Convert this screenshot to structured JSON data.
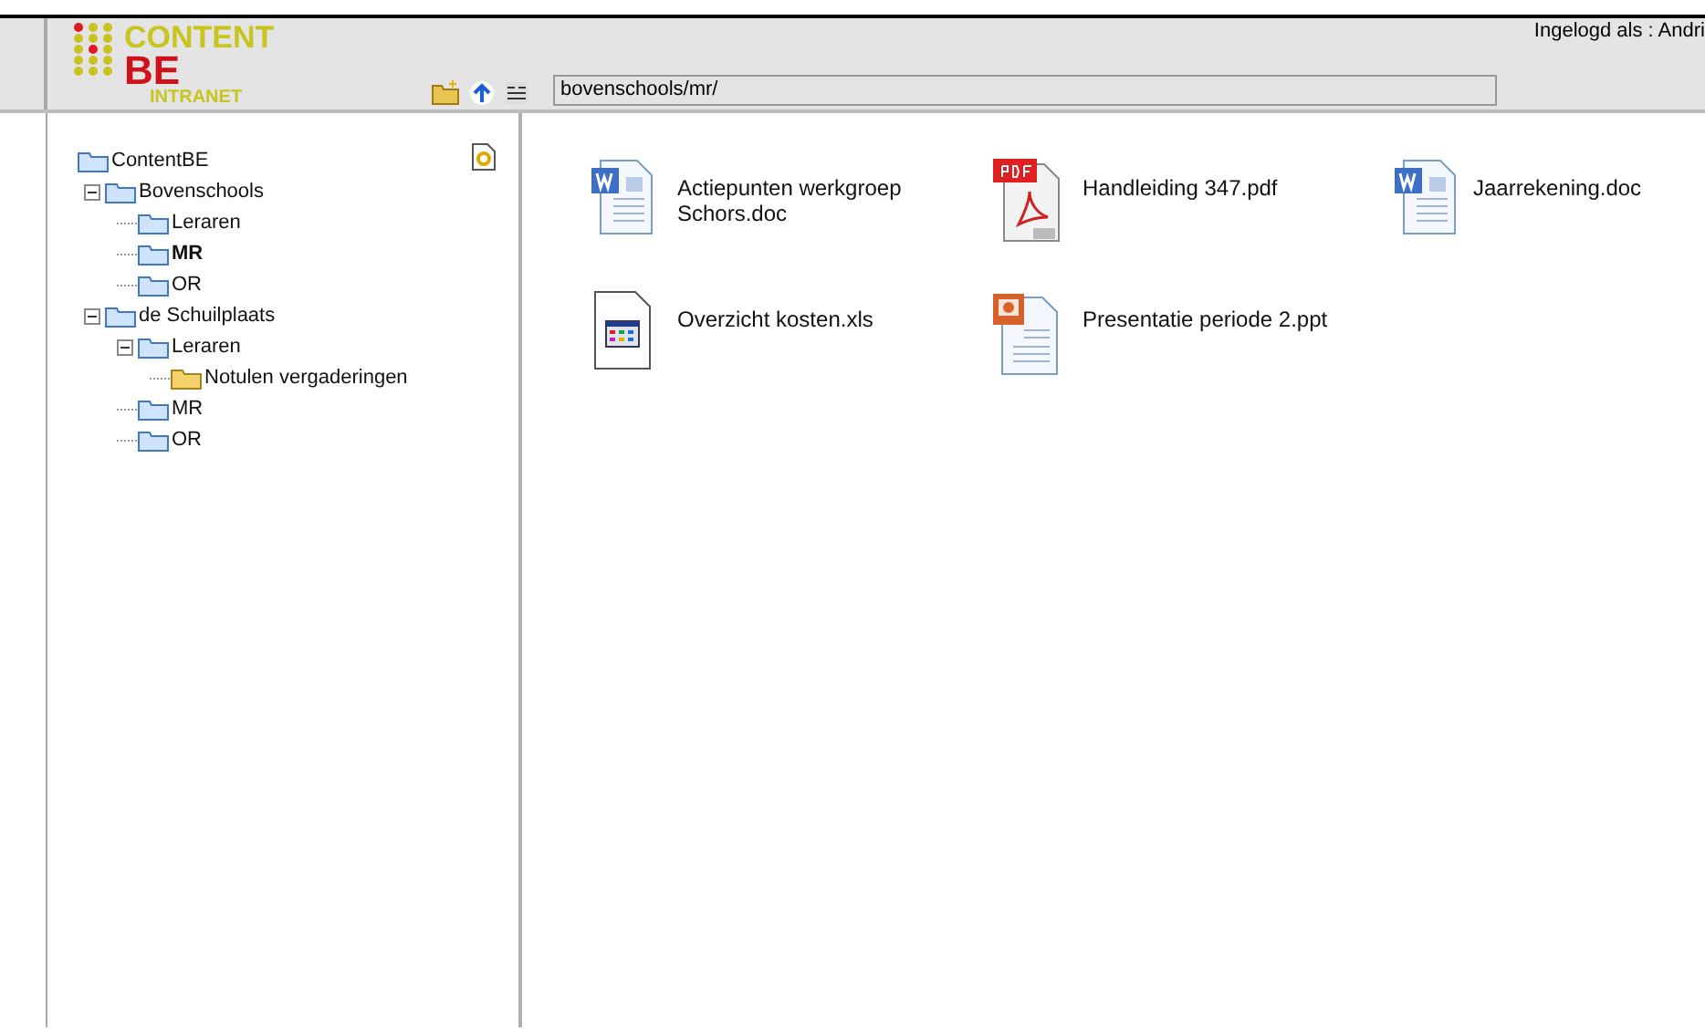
{
  "logo": {
    "line_1": "CONTENT",
    "line_2": "BE",
    "line_3": "INTRANET"
  },
  "user_label": "Ingelogd als : Andri",
  "path_field": {
    "value": "bovenschools/mr/"
  },
  "tree": [
    {
      "label": "ContentBE",
      "selected": false,
      "children": [
        {
          "label": "Bovenschools",
          "selected": false,
          "expanded": true,
          "children": [
            {
              "label": "Leraren",
              "selected": false
            },
            {
              "label": "MR",
              "selected": true
            },
            {
              "label": "OR",
              "selected": false
            }
          ]
        },
        {
          "label": "de Schuilplaats",
          "selected": false,
          "expanded": true,
          "children": [
            {
              "label": "Leraren",
              "selected": false,
              "expanded": true,
              "children": [
                {
                  "label": "Notulen vergaderingen",
                  "selected": false,
                  "kind": "plain"
                }
              ]
            },
            {
              "label": "MR",
              "selected": false
            },
            {
              "label": "OR",
              "selected": false
            }
          ]
        }
      ]
    }
  ],
  "files": [
    {
      "name": "Actiepunten werkgroep Schors.doc",
      "kind": "doc"
    },
    {
      "name": "Handleiding 347.pdf",
      "kind": "pdf"
    },
    {
      "name": "Jaarrekening.doc",
      "kind": "doc"
    },
    {
      "name": "Overzicht kosten.xls",
      "kind": "xls"
    },
    {
      "name": "Presentatie periode 2.ppt",
      "kind": "ppt"
    }
  ]
}
